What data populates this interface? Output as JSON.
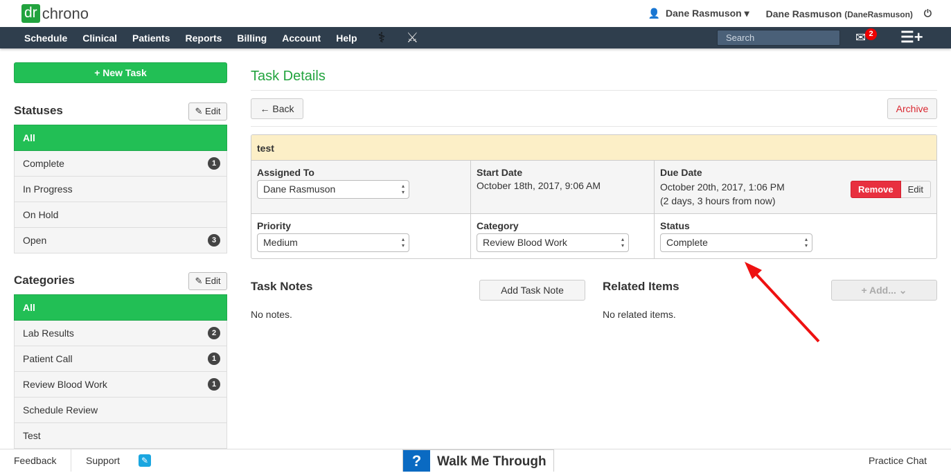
{
  "brand": {
    "logo_dr": "dr",
    "logo_rest": "chrono"
  },
  "user": {
    "menu_name": "Dane Rasmuson",
    "name": "Dane Rasmuson",
    "username": "(DaneRasmuson)"
  },
  "nav": {
    "items": [
      "Schedule",
      "Clinical",
      "Patients",
      "Reports",
      "Billing",
      "Account",
      "Help"
    ],
    "search_placeholder": "Search",
    "mail_count": "2"
  },
  "sidebar": {
    "new_task": "+ New Task",
    "statuses_title": "Statuses",
    "edit": "Edit",
    "statuses": [
      {
        "label": "All",
        "active": true
      },
      {
        "label": "Complete",
        "count": "1"
      },
      {
        "label": "In Progress"
      },
      {
        "label": "On Hold"
      },
      {
        "label": "Open",
        "count": "3"
      }
    ],
    "categories_title": "Categories",
    "categories": [
      {
        "label": "All",
        "active": true
      },
      {
        "label": "Lab Results",
        "count": "2"
      },
      {
        "label": "Patient Call",
        "count": "1"
      },
      {
        "label": "Review Blood Work",
        "count": "1"
      },
      {
        "label": "Schedule Review"
      },
      {
        "label": "Test"
      }
    ]
  },
  "main": {
    "title": "Task Details",
    "back": "← Back",
    "archive": "Archive",
    "task": {
      "name": "test",
      "assigned_label": "Assigned To",
      "assigned": "Dane Rasmuson",
      "start_label": "Start Date",
      "start": "October 18th, 2017, 9:06 AM",
      "due_label": "Due Date",
      "due": "October 20th, 2017, 1:06 PM",
      "due_rel": "(2 days, 3 hours from now)",
      "remove": "Remove",
      "edit": "Edit",
      "priority_label": "Priority",
      "priority": "Medium",
      "category_label": "Category",
      "category": "Review Blood Work",
      "status_label": "Status",
      "status": "Complete"
    },
    "notes_title": "Task Notes",
    "add_note": "Add Task Note",
    "no_notes": "No notes.",
    "related_title": "Related Items",
    "add_related": "+ Add... ⌄",
    "no_related": "No related items."
  },
  "footer": {
    "feedback": "Feedback",
    "support": "Support",
    "walk": "Walk Me Through",
    "walk_icon": "?",
    "chat": "Practice Chat"
  },
  "colors": {
    "brand_green": "#22bf55",
    "nav_bg": "#2f3e4d",
    "danger": "#e8303f",
    "annotation_arrow": "#ee1111"
  }
}
